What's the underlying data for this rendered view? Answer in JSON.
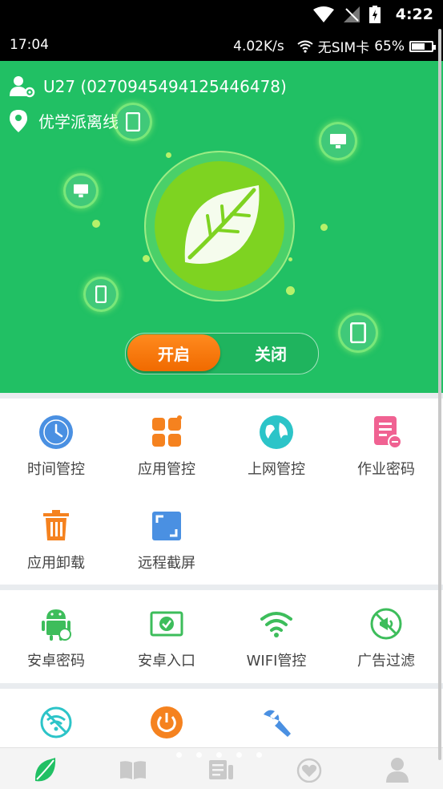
{
  "system": {
    "time": "4:22"
  },
  "status": {
    "time": "17:04",
    "speed": "4.02K/s",
    "sim": "无SIM卡",
    "battery": "65%",
    "battery_level": 0.65
  },
  "device": {
    "name": "U27 (0270945494125446478)",
    "location": "优学派离线"
  },
  "toggle": {
    "on": "开启",
    "off": "关闭"
  },
  "section1": [
    {
      "label": "时间管控",
      "icon": "clock-icon",
      "color": "#4a90e2"
    },
    {
      "label": "应用管控",
      "icon": "apps-icon",
      "color": "#f5821f"
    },
    {
      "label": "上网管控",
      "icon": "globe-icon",
      "color": "#2cc4c8"
    },
    {
      "label": "作业密码",
      "icon": "homework-icon",
      "color": "#f06292"
    },
    {
      "label": "应用卸载",
      "icon": "trash-icon",
      "color": "#f5821f"
    },
    {
      "label": "远程截屏",
      "icon": "screenshot-icon",
      "color": "#4a90e2"
    }
  ],
  "section2": [
    {
      "label": "安卓密码",
      "icon": "android-icon",
      "color": "#3dbd5b"
    },
    {
      "label": "安卓入口",
      "icon": "android-entry-icon",
      "color": "#3dbd5b"
    },
    {
      "label": "WIFI管控",
      "icon": "wifi-icon",
      "color": "#3dbd5b"
    },
    {
      "label": "广告过滤",
      "icon": "ad-filter-icon",
      "color": "#3dbd5b"
    }
  ],
  "section3": [
    {
      "icon": "no-wifi-icon",
      "color": "#2cc4c8"
    },
    {
      "icon": "power-icon",
      "color": "#f5821f"
    },
    {
      "icon": "wrench-icon",
      "color": "#4a90e2"
    }
  ],
  "nav": [
    {
      "name": "nav-home",
      "icon": "leaf-icon"
    },
    {
      "name": "nav-book",
      "icon": "book-icon"
    },
    {
      "name": "nav-news",
      "icon": "news-icon"
    },
    {
      "name": "nav-care",
      "icon": "heart-icon"
    },
    {
      "name": "nav-profile",
      "icon": "user-icon"
    }
  ]
}
